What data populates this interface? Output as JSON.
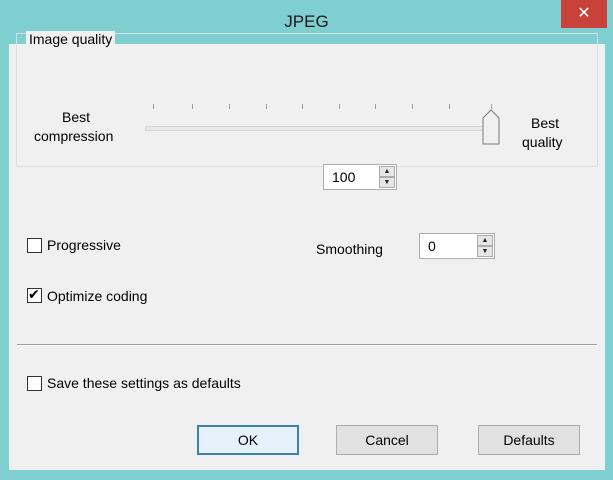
{
  "window": {
    "title": "JPEG",
    "close_icon": "close-icon"
  },
  "image_quality": {
    "group_label": "Image quality",
    "left_label_line1": "Best",
    "left_label_line2": "compression",
    "right_label_line1": "Best",
    "right_label_line2": "quality",
    "slider_value_fraction": 1.0,
    "quality_value": "100"
  },
  "progressive": {
    "label": "Progressive",
    "checked": false
  },
  "smoothing": {
    "label": "Smoothing",
    "value": "0"
  },
  "optimize_coding": {
    "label": "Optimize coding",
    "checked": true
  },
  "save_defaults": {
    "label": "Save these settings as defaults",
    "checked": false
  },
  "buttons": {
    "ok": "OK",
    "cancel": "Cancel",
    "defaults": "Defaults"
  },
  "colors": {
    "titlebar": "#7fcfd0",
    "close_button": "#c8413a",
    "client": "#f0f0f0"
  }
}
